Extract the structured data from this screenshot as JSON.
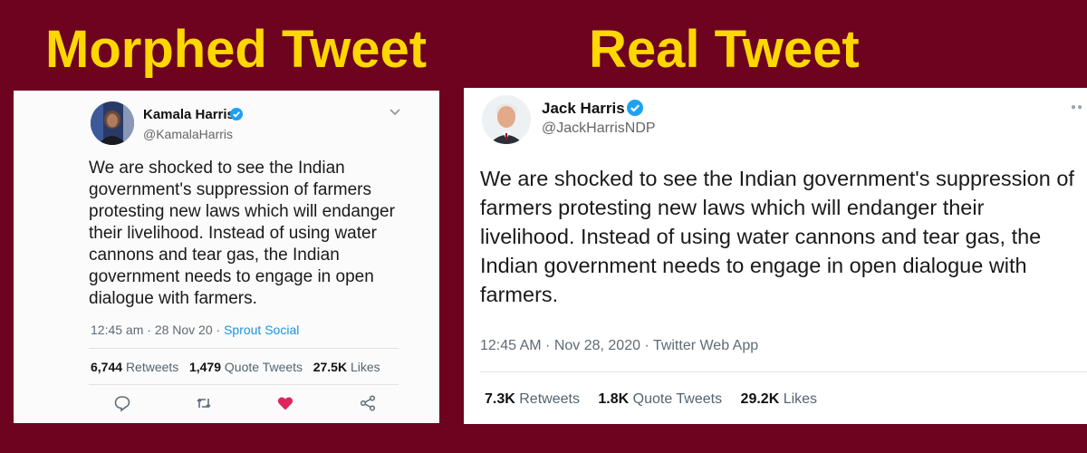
{
  "headings": {
    "left": "Morphed Tweet",
    "right": "Real Tweet"
  },
  "colors": {
    "background": "#6e0320",
    "heading": "#ffd700",
    "verified": "#1da1f2",
    "like": "#e0245e",
    "link": "#1b95e0"
  },
  "morphed_tweet": {
    "name": "Kamala Harris",
    "handle": "@KamalaHarris",
    "text": "We are shocked to see the Indian government's suppression of farmers protesting new laws which will endanger their livelihood. Instead of using water cannons and tear gas, the Indian government needs to engage in open dialogue with farmers.",
    "timestamp": "12:45 am · 28 Nov 20 · ",
    "source": "Sprout Social",
    "retweets": "6,744",
    "retweets_label": "Retweets",
    "quote_tweets": "1,479",
    "quote_tweets_label": "Quote Tweets",
    "likes": "27.5K",
    "likes_label": "Likes",
    "icons": [
      "reply-icon",
      "retweet-icon",
      "like-icon",
      "share-icon",
      "chevron-down-icon",
      "verified-icon"
    ]
  },
  "real_tweet": {
    "name": "Jack Harris",
    "handle": "@JackHarrisNDP",
    "text": "We are shocked to see the Indian government's suppression of farmers protesting new laws which will endanger their livelihood. Instead of using water cannons and tear gas, the Indian government needs to engage in open dialogue with farmers.",
    "timestamp": "12:45 AM · Nov 28, 2020 · Twitter Web App",
    "retweets": "7.3K",
    "retweets_label": "Retweets",
    "quote_tweets": "1.8K",
    "quote_tweets_label": "Quote Tweets",
    "likes": "29.2K",
    "likes_label": "Likes",
    "icons": [
      "verified-icon",
      "more-icon"
    ]
  }
}
